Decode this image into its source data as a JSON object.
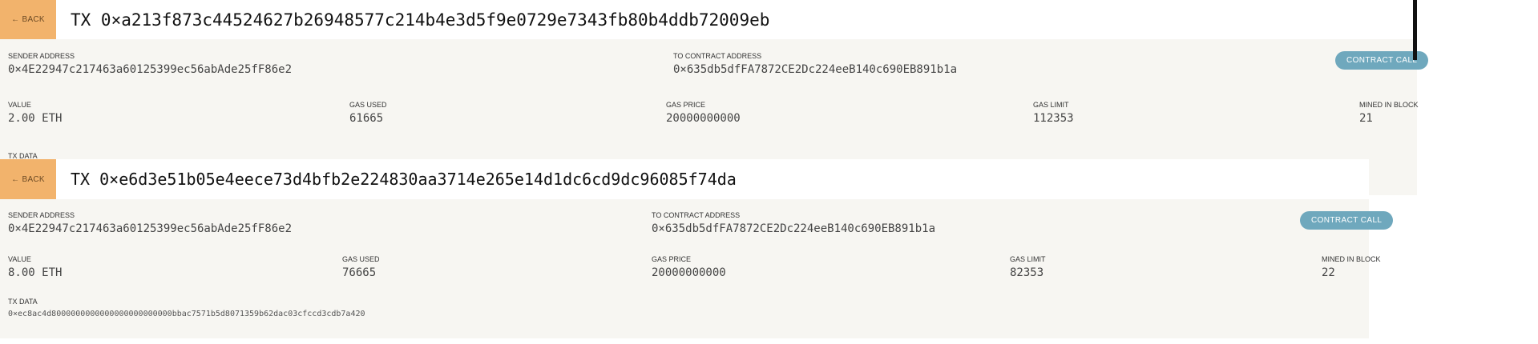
{
  "transactions": [
    {
      "back_label": "← BACK",
      "title": "TX 0×a213f873c44524627b26948577c214b4e3d5f9e0729e7343fb80b4ddb72009eb",
      "sender_label": "SENDER ADDRESS",
      "sender": "0×4E22947c217463a60125399ec56abAde25fF86e2",
      "to_label": "TO CONTRACT ADDRESS",
      "to": "0×635db5dfFA7872CE2Dc224eeB140c690EB891b1a",
      "badge": "CONTRACT CALL",
      "value_label": "VALUE",
      "value": "2.00 ETH",
      "gas_used_label": "GAS USED",
      "gas_used": "61665",
      "gas_price_label": "GAS PRICE",
      "gas_price": "20000000000",
      "gas_limit_label": "GAS LIMIT",
      "gas_limit": "112353",
      "block_label": "MINED IN BLOCK",
      "block": "21",
      "tx_data_label": "TX DATA"
    },
    {
      "back_label": "← BACK",
      "title": "TX 0×e6d3e51b05e4eece73d4bfb2e224830aa3714e265e14d1dc6cd9dc96085f74da",
      "sender_label": "SENDER ADDRESS",
      "sender": "0×4E22947c217463a60125399ec56abAde25fF86e2",
      "to_label": "TO CONTRACT ADDRESS",
      "to": "0×635db5dfFA7872CE2Dc224eeB140c690EB891b1a",
      "badge": "CONTRACT CALL",
      "value_label": "VALUE",
      "value": "8.00 ETH",
      "gas_used_label": "GAS USED",
      "gas_used": "76665",
      "gas_price_label": "GAS PRICE",
      "gas_price": "20000000000",
      "gas_limit_label": "GAS LIMIT",
      "gas_limit": "82353",
      "block_label": "MINED IN BLOCK",
      "block": "22",
      "tx_data_label": "TX DATA",
      "tx_data": "0×ec8ac4d8000000000000000000000000bbac7571b5d8071359b62dac03cfccd3cdb7a420"
    }
  ]
}
